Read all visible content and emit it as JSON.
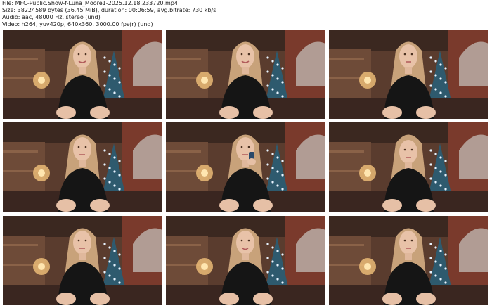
{
  "header": {
    "file_line": "File: MFC-Public.Show-f-Luna_Moore1-2025.12.18.233720.mp4",
    "size_line": "Size: 38224589 bytes (36.45 MiB), duration: 00:06:59, avg.bitrate: 730 kb/s",
    "audio_line": "Audio: aac, 48000 Hz, stereo (und)",
    "video_line": "Video: h264, yuv420p, 640x360, 3000.00 fps(r) (und)"
  },
  "thumbnails": [
    {
      "variant": "smile"
    },
    {
      "variant": "smile"
    },
    {
      "variant": "neutral"
    },
    {
      "variant": "neutral"
    },
    {
      "variant": "phone"
    },
    {
      "variant": "looking-down"
    },
    {
      "variant": "neutral"
    },
    {
      "variant": "talking"
    },
    {
      "variant": "neutral"
    }
  ]
}
